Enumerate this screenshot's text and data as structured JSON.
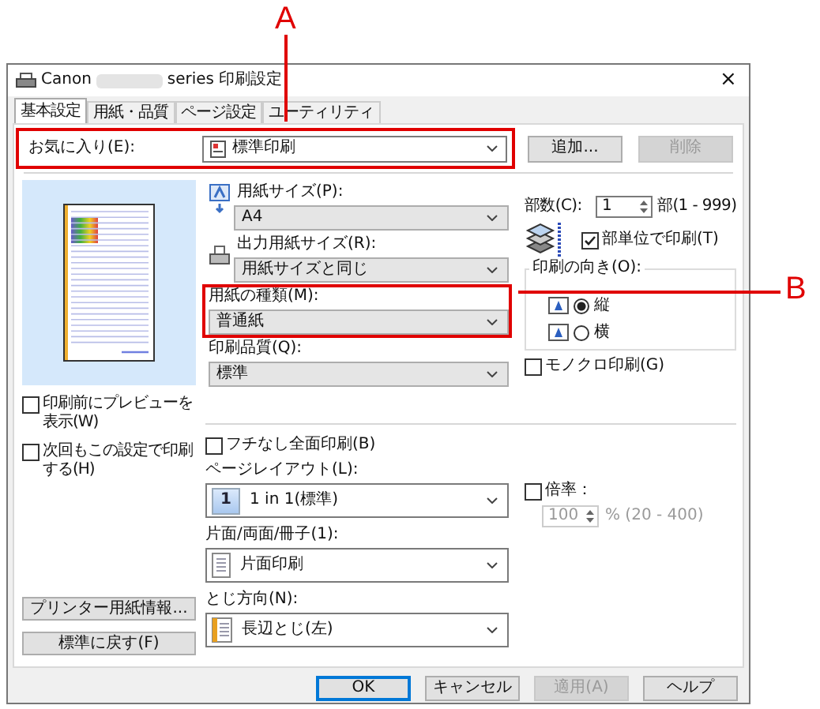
{
  "callouts": [
    {
      "label": "A"
    },
    {
      "label": "B"
    }
  ],
  "window": {
    "title_prefix": "Canon",
    "title_suffix": "series 印刷設定",
    "close": "×"
  },
  "tabs": [
    {
      "label": "基本設定",
      "selected": true
    },
    {
      "label": "用紙・品質",
      "selected": false
    },
    {
      "label": "ページ設定",
      "selected": false
    },
    {
      "label": "ユーティリティ",
      "selected": false
    }
  ],
  "favorites": {
    "label": "お気に入り(E):",
    "value": "標準印刷",
    "highlighted": true
  },
  "favorite_buttons": [
    {
      "label": "追加...",
      "disabled": false
    },
    {
      "label": "削除",
      "disabled": true
    }
  ],
  "left_options": [
    {
      "label": "印刷前にプレビューを表示(W)",
      "checked": false
    },
    {
      "label": "次回もこの設定で印刷する(H)",
      "checked": false
    }
  ],
  "left_buttons": [
    "プリンター用紙情報...",
    "標準に戻す(F)"
  ],
  "media_fields": [
    {
      "label": "用紙サイズ(P):",
      "value": "A4",
      "kind": "paper-size"
    },
    {
      "label": "出力用紙サイズ(R):",
      "value": "用紙サイズと同じ",
      "kind": "output-size"
    },
    {
      "label": "用紙の種類(M):",
      "value": "普通紙",
      "kind": "plain",
      "highlighted": true
    },
    {
      "label": "印刷品質(Q):",
      "value": "標準",
      "kind": "plain"
    }
  ],
  "copies": {
    "label": "部数(C):",
    "value": "1",
    "unit": "部(1 - 999)"
  },
  "collate": {
    "label": "部単位で印刷(T)",
    "checked": true
  },
  "orientation": {
    "label": "印刷の向き(O):",
    "options": [
      {
        "label": "縦",
        "selected": true
      },
      {
        "label": "横",
        "selected": false
      }
    ]
  },
  "grayscale": {
    "label": "モノクロ印刷(G)",
    "checked": false
  },
  "borderless": {
    "label": "フチなし全面印刷(B)",
    "checked": false
  },
  "layout_fields": [
    {
      "label": "ページレイアウト(L):",
      "value": "1 in 1(標準)",
      "kind": "page-layout",
      "badge": "1"
    },
    {
      "label": "片面/両面/冊子(1):",
      "value": "片面印刷",
      "kind": "single-sided"
    },
    {
      "label": "とじ方向(N):",
      "value": "長辺とじ(左)",
      "kind": "long-edge"
    }
  ],
  "scale": {
    "label": "倍率：",
    "checked": false,
    "value": "100",
    "range": "% (20 - 400)",
    "disabled": true
  },
  "dialog_buttons": [
    {
      "label": "OK",
      "disabled": false,
      "default": true
    },
    {
      "label": "キャンセル",
      "disabled": false,
      "default": false
    },
    {
      "label": "適用(A)",
      "disabled": true,
      "default": false
    },
    {
      "label": "ヘルプ",
      "disabled": false,
      "default": false
    }
  ]
}
